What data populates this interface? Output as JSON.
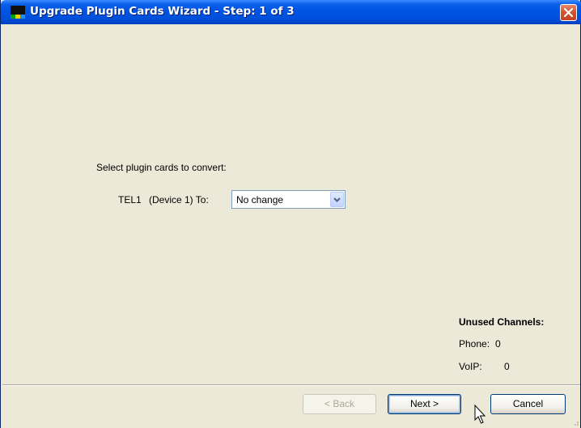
{
  "window": {
    "title": "Upgrade Plugin Cards Wizard - Step: 1 of 3"
  },
  "content": {
    "instruction": "Select plugin cards to convert:",
    "card_name": "TEL1",
    "card_device_label": "(Device 1) To:",
    "conversion_select": {
      "value": "No change"
    }
  },
  "unused_channels": {
    "title": "Unused Channels:",
    "phone_label": "Phone:",
    "phone_value": "0",
    "voip_label": "VoIP:",
    "voip_value": "0"
  },
  "footer": {
    "back_label": "< Back",
    "next_label": "Next >",
    "cancel_label": "Cancel"
  },
  "colors": {
    "titlebar": "#0054E3",
    "window_bg": "#ECE9D8",
    "close_button": "#D4552F"
  }
}
